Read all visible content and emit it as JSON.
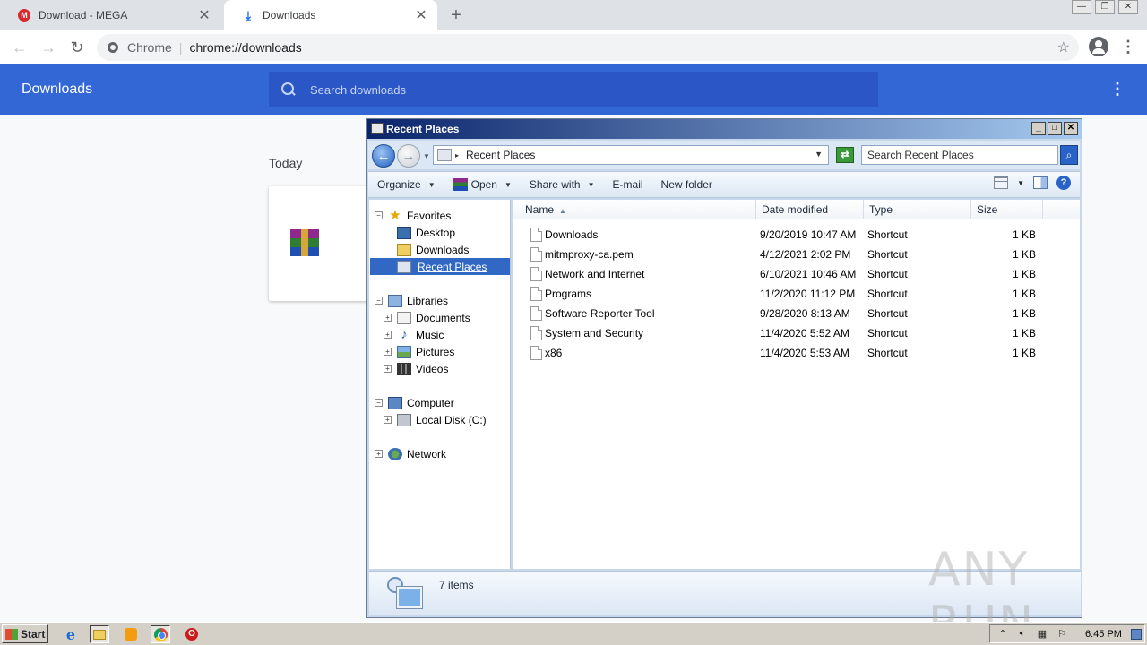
{
  "browser": {
    "tabs": [
      {
        "title": "Download - MEGA",
        "icon": "mega-icon"
      },
      {
        "title": "Downloads",
        "icon": "download-icon"
      }
    ],
    "omnibox": {
      "scheme_label": "Chrome",
      "url": "chrome://downloads"
    }
  },
  "downloads_page": {
    "title": "Downloads",
    "search_placeholder": "Search downloads",
    "section_today": "Today",
    "header_color": "#3367d6"
  },
  "explorer": {
    "title": "Recent Places",
    "address": "Recent Places",
    "search_placeholder": "Search Recent Places",
    "commands": {
      "organize": "Organize",
      "open": "Open",
      "share_with": "Share with",
      "email": "E-mail",
      "new_folder": "New folder"
    },
    "nav": {
      "favorites": "Favorites",
      "desktop": "Desktop",
      "downloads": "Downloads",
      "recent_places": "Recent Places",
      "libraries": "Libraries",
      "documents": "Documents",
      "music": "Music",
      "pictures": "Pictures",
      "videos": "Videos",
      "computer": "Computer",
      "local_disk": "Local Disk (C:)",
      "network": "Network"
    },
    "columns": {
      "name": "Name",
      "date": "Date modified",
      "type": "Type",
      "size": "Size"
    },
    "files": [
      {
        "name": "Downloads",
        "date": "9/20/2019 10:47 AM",
        "type": "Shortcut",
        "size": "1 KB"
      },
      {
        "name": "mitmproxy-ca.pem",
        "date": "4/12/2021 2:02 PM",
        "type": "Shortcut",
        "size": "1 KB"
      },
      {
        "name": "Network and Internet",
        "date": "6/10/2021 10:46 AM",
        "type": "Shortcut",
        "size": "1 KB"
      },
      {
        "name": "Programs",
        "date": "11/2/2020 11:12 PM",
        "type": "Shortcut",
        "size": "1 KB"
      },
      {
        "name": "Software Reporter Tool",
        "date": "9/28/2020 8:13 AM",
        "type": "Shortcut",
        "size": "1 KB"
      },
      {
        "name": "System and Security",
        "date": "11/4/2020 5:52 AM",
        "type": "Shortcut",
        "size": "1 KB"
      },
      {
        "name": "x86",
        "date": "11/4/2020 5:53 AM",
        "type": "Shortcut",
        "size": "1 KB"
      }
    ],
    "item_count": "7 items"
  },
  "watermark": "ANY RUN",
  "taskbar": {
    "start_label": "Start",
    "clock": "6:45 PM"
  }
}
